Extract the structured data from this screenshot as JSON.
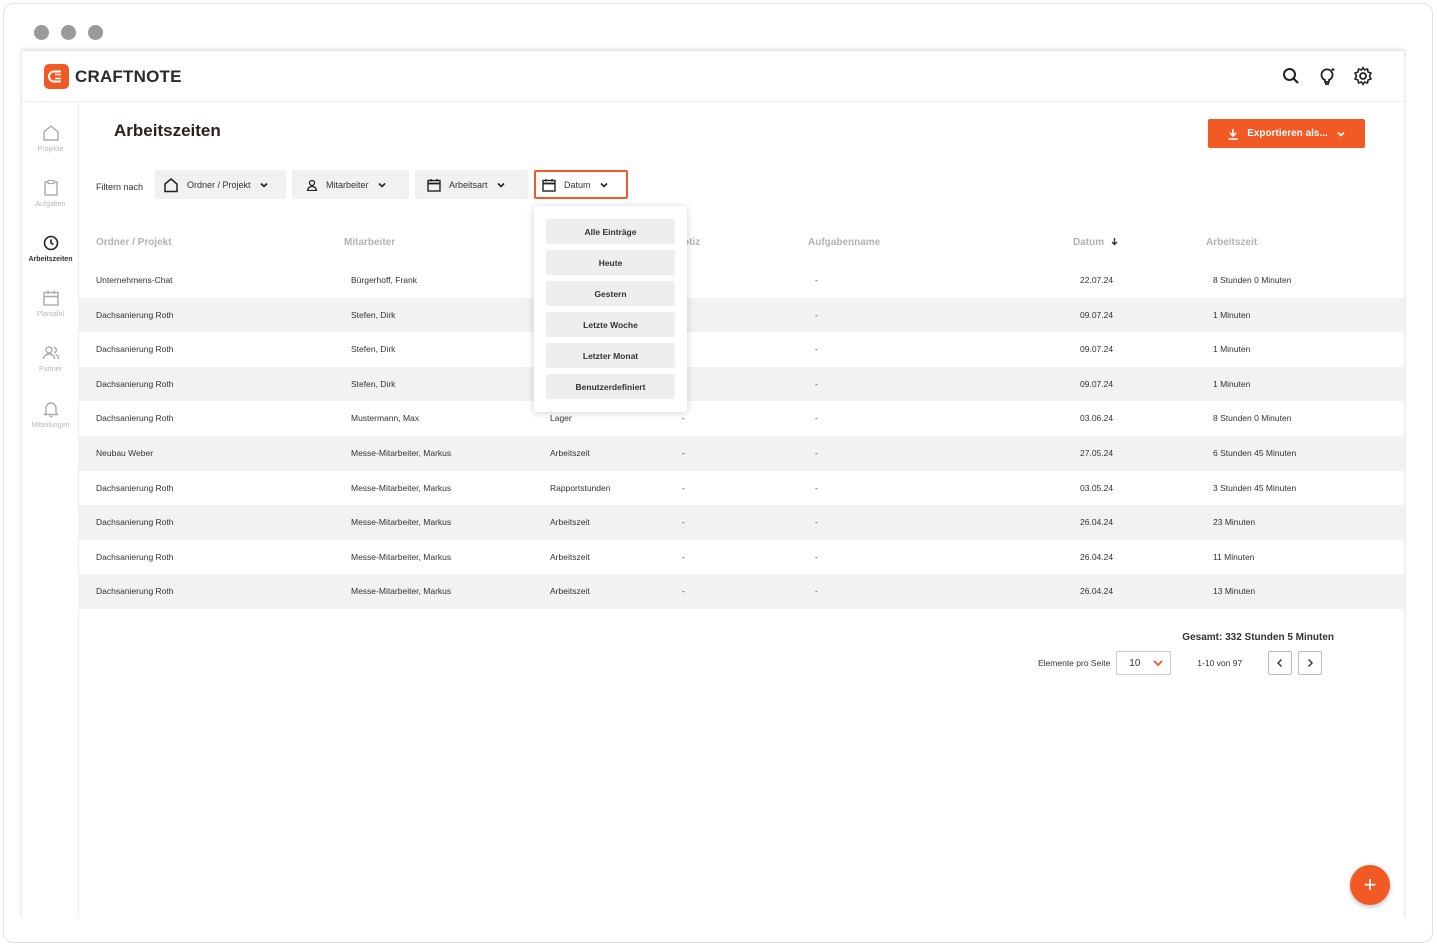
{
  "brand": {
    "name": "CRAFTNOTE",
    "accent": "#f15a24"
  },
  "topbar_icons": [
    "search-icon",
    "lightbulb-icon",
    "gear-icon"
  ],
  "sidebar": {
    "items": [
      {
        "label": "Projekte",
        "icon": "home-icon"
      },
      {
        "label": "Aufgaben",
        "icon": "clipboard-icon"
      },
      {
        "label": "Arbeitszeiten",
        "icon": "clock-icon",
        "active": true
      },
      {
        "label": "Plantafel",
        "icon": "calendar-icon"
      },
      {
        "label": "Partner",
        "icon": "people-icon"
      },
      {
        "label": "Mitteilungen",
        "icon": "bell-icon"
      }
    ]
  },
  "page": {
    "title": "Arbeitszeiten",
    "export_label": "Exportieren als..."
  },
  "filters": {
    "label": "Filtern nach",
    "project": "Ordner / Projekt",
    "employee": "Mitarbeiter",
    "worktype": "Arbeitsart",
    "date": "Datum"
  },
  "date_menu": {
    "options": [
      "Alle Einträge",
      "Heute",
      "Gestern",
      "Letzte Woche",
      "Letzter Monat",
      "Benutzerdefiniert"
    ]
  },
  "table": {
    "headers": {
      "project": "Ordner / Projekt",
      "employee": "Mitarbeiter",
      "note": "otiz",
      "task": "Aufgabenname",
      "date": "Datum",
      "worktime": "Arbeitszeit"
    },
    "rows": [
      {
        "project": "Unternehmens-Chat",
        "employee": "Bürgerhoff, Frank",
        "type": "",
        "note": "",
        "task": "-",
        "date": "22.07.24",
        "worktime": "8 Stunden 0 Minuten"
      },
      {
        "project": "Dachsanierung Roth",
        "employee": "Stefen, Dirk",
        "type": "",
        "note": "",
        "task": "-",
        "date": "09.07.24",
        "worktime": "1 Minuten"
      },
      {
        "project": "Dachsanierung Roth",
        "employee": "Stefen, Dirk",
        "type": "",
        "note": "",
        "task": "-",
        "date": "09.07.24",
        "worktime": "1 Minuten"
      },
      {
        "project": "Dachsanierung Roth",
        "employee": "Stefen, Dirk",
        "type": "",
        "note": "",
        "task": "-",
        "date": "09.07.24",
        "worktime": "1 Minuten"
      },
      {
        "project": "Dachsanierung Roth",
        "employee": "Mustermann, Max",
        "type": "Lager",
        "note": "-",
        "task": "-",
        "date": "03.06.24",
        "worktime": "8 Stunden 0 Minuten"
      },
      {
        "project": "Neubau Weber",
        "employee": "Messe-Mitarbeiter, Markus",
        "type": "Arbeitszeit",
        "note": "-",
        "task": "-",
        "date": "27.05.24",
        "worktime": "6 Stunden 45 Minuten"
      },
      {
        "project": "Dachsanierung Roth",
        "employee": "Messe-Mitarbeiter, Markus",
        "type": "Rapportstunden",
        "note": "-",
        "task": "-",
        "date": "03.05.24",
        "worktime": "3 Stunden 45 Minuten"
      },
      {
        "project": "Dachsanierung Roth",
        "employee": "Messe-Mitarbeiter, Markus",
        "type": "Arbeitszeit",
        "note": "-",
        "task": "-",
        "date": "26.04.24",
        "worktime": "23 Minuten"
      },
      {
        "project": "Dachsanierung Roth",
        "employee": "Messe-Mitarbeiter, Markus",
        "type": "Arbeitszeit",
        "note": "-",
        "task": "-",
        "date": "26.04.24",
        "worktime": "11 Minuten"
      },
      {
        "project": "Dachsanierung Roth",
        "employee": "Messe-Mitarbeiter, Markus",
        "type": "Arbeitszeit",
        "note": "-",
        "task": "-",
        "date": "26.04.24",
        "worktime": "13 Minuten"
      }
    ]
  },
  "summary": {
    "total": "Gesamt: 332 Stunden 5 Minuten"
  },
  "pagination": {
    "per_page_label": "Elemente pro Seite",
    "per_page_value": "10",
    "range": "1-10 von 97"
  },
  "fab": {
    "label": "+"
  }
}
